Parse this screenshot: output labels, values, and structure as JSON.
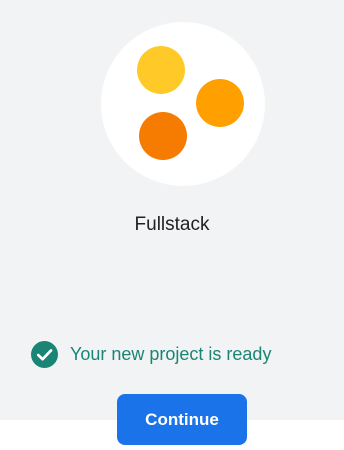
{
  "project": {
    "name": "Fullstack",
    "logo_icon": "three-dots-logo-icon",
    "logo_colors": [
      "#ffca28",
      "#ffa000",
      "#f57c00"
    ]
  },
  "status": {
    "icon": "check-circle-icon",
    "icon_color": "#1a8574",
    "text": "Your new project is ready"
  },
  "actions": {
    "continue_label": "Continue",
    "continue_color": "#1a73e8"
  }
}
